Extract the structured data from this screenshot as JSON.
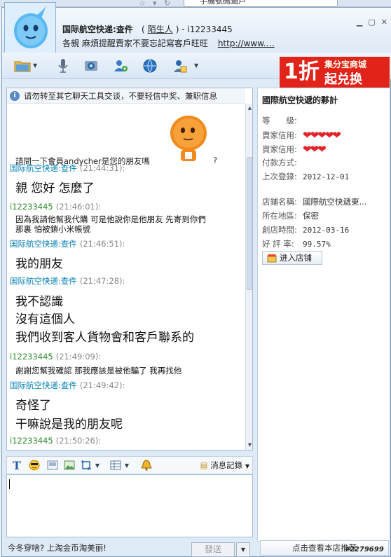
{
  "browser": {
    "tab_text": "手機號碼過戶"
  },
  "window": {
    "title": "国际航空快递:查件",
    "title_stranger": "陌生人",
    "title_paren_open": "(",
    "title_paren_close": ")",
    "title_sep": "-",
    "title_user": "i12233445",
    "notice": "各親 麻煩提醒賣家不要忘記寫客戶旺旺",
    "notice_link": "http://www.…"
  },
  "ad": {
    "discount": "1折",
    "shop": "集分宝商城",
    "redeem": "起兑换"
  },
  "warning": "请勿转至其它聊天工具交谈，不要轻信中奖、兼职信息",
  "question": "請問一下會員andycher是您的朋友嗎",
  "question_mark": "?",
  "messages": [
    {
      "sender": "国际航空快递:查件",
      "time": "(21:44:31):",
      "side": "them"
    },
    {
      "text": "親 您好 怎麼了"
    },
    {
      "sender": "i12233445",
      "time": "(21:46:01):",
      "side": "me"
    },
    {
      "text": "因為我請他幫我代購 可是他說你是他朋友 先寄到你們"
    },
    {
      "text": "那裏 怕被鎖小米帳號"
    },
    {
      "sender": "国际航空快递:查件",
      "time": "(21:46:51):",
      "side": "them"
    },
    {
      "text": "我的朋友"
    },
    {
      "sender": "国际航空快递:查件",
      "time": "(21:47:28):",
      "side": "them"
    },
    {
      "text": "我不認識"
    },
    {
      "text": "沒有這個人"
    },
    {
      "text": "我們收到客人貨物會和客戶聯系的"
    },
    {
      "sender": "i12233445",
      "time": "(21:49:09):",
      "side": "me"
    },
    {
      "text": "謝謝您幫我確認 那我應該是被他騙了 我再找他"
    },
    {
      "sender": "国际航空快递:查件",
      "time": "(21:49:42):",
      "side": "them"
    },
    {
      "text": "奇怪了"
    },
    {
      "text": "干嘛說是我的朋友呢"
    },
    {
      "sender": "i12233445",
      "time": "(21:50:26):",
      "side": "me"
    }
  ],
  "format_bar": {
    "history_label": "消息記錄"
  },
  "input": {
    "value": ""
  },
  "promo": "今冬穿啥? 上淘金币淘美丽!",
  "send_label": "發送",
  "panel": {
    "title": "國際航空快遞的夥計",
    "level_label": "等　　級:",
    "seller_credit_label": "賣家信用:",
    "buyer_credit_label": "買家信用:",
    "payment_label": "付款方式:",
    "last_login_label": "上次登錄:",
    "last_login": "2012-12-01",
    "shop_name_label": "店鋪名稱:",
    "shop_name": "國際航空快遞東...",
    "region_label": "所在地區:",
    "region": "保密",
    "created_label": "創店時間:",
    "created": "2012-03-16",
    "rating_label": "好 評 率:",
    "rating": "99.57%",
    "enter_shop": "进入店铺",
    "seller_hearts": "❤❤❤❤❤",
    "buyer_hearts": "❤❤❤"
  },
  "bottom_button": "点击查看本店推荐",
  "watermark": "#2279699",
  "colors": {
    "them": "#007fb4",
    "me": "#2e8b2e",
    "heart": "#e3242b",
    "ad_bg": "#e2231a"
  }
}
